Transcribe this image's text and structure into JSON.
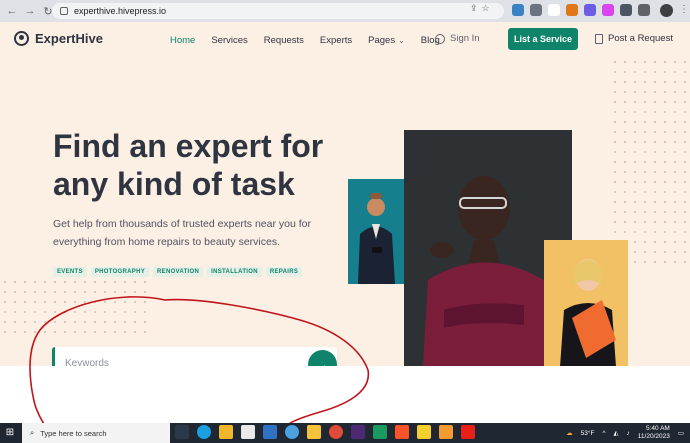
{
  "browser": {
    "url": "experthive.hivepress.io"
  },
  "site": {
    "logo_text": "ExpertHive",
    "nav": [
      {
        "label": "Home"
      },
      {
        "label": "Services"
      },
      {
        "label": "Requests"
      },
      {
        "label": "Experts"
      },
      {
        "label": "Pages"
      },
      {
        "label": "Blog"
      }
    ],
    "signin_label": "Sign In",
    "list_service_label": "List a Service",
    "post_request_label": "Post a Request"
  },
  "hero": {
    "headline_line1": "Find an expert for",
    "headline_line2": "any kind of task",
    "subtext": "Get help from thousands of trusted experts near you for everything from home repairs to beauty services.",
    "tags": [
      "EVENTS",
      "PHOTOGRAPHY",
      "RENOVATION",
      "INSTALLATION",
      "REPAIRS"
    ],
    "search_placeholder": "Keywords"
  },
  "taskbar": {
    "search_placeholder": "Type here to search",
    "weather": "53°F",
    "time": "5:40 AM",
    "date": "11/20/2023"
  },
  "colors": {
    "accent": "#10846b",
    "page_bg": "#fcefe4",
    "annotation": "#c0141c"
  }
}
